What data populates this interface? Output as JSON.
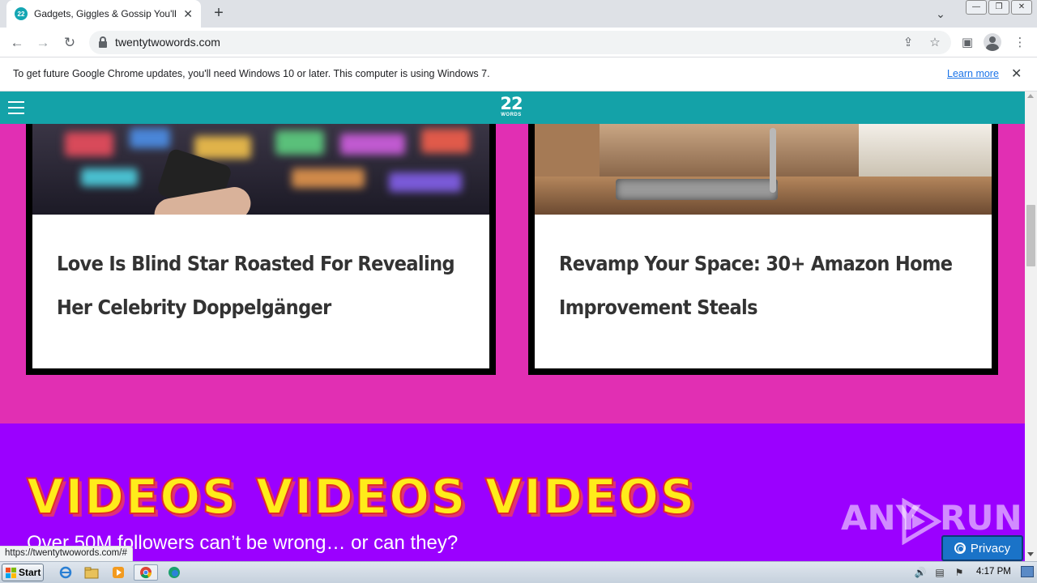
{
  "browser": {
    "tab_title": "Gadgets, Giggles & Gossip You'll Love",
    "favicon_text": "22",
    "url": "twentytwowords.com",
    "infobar_text": "To get future Google Chrome updates, you'll need Windows 10 or later. This computer is using Windows 7.",
    "infobar_link": "Learn more",
    "status_url": "https://twentytwowords.com/#"
  },
  "site": {
    "logo_number": "22",
    "logo_word": "WORDS",
    "cards": [
      {
        "title_line1": "Love Is Blind Star Roasted For Revealing",
        "title_line2": "Her Celebrity Doppelgänger"
      },
      {
        "title_line1": "Revamp Your Space: 30+ Amazon Home",
        "title_line2": "Improvement Steals"
      }
    ],
    "videos_heading": "VIDEOS VIDEOS VIDEOS",
    "videos_subtitle": "Over 50M followers can’t be wrong… or can they?",
    "privacy_label": "Privacy",
    "colors": {
      "header": "#14a2a8",
      "background": "#e12fb3",
      "videos_band": "#9b00ff",
      "title_underline": "#f7a8d9"
    }
  },
  "watermark": {
    "left": "ANY",
    "right": "RUN"
  },
  "taskbar": {
    "start_label": "Start",
    "clock": "4:17 PM",
    "icons": [
      "ie-icon",
      "explorer-icon",
      "media-player-icon",
      "chrome-icon",
      "edge-icon"
    ]
  }
}
